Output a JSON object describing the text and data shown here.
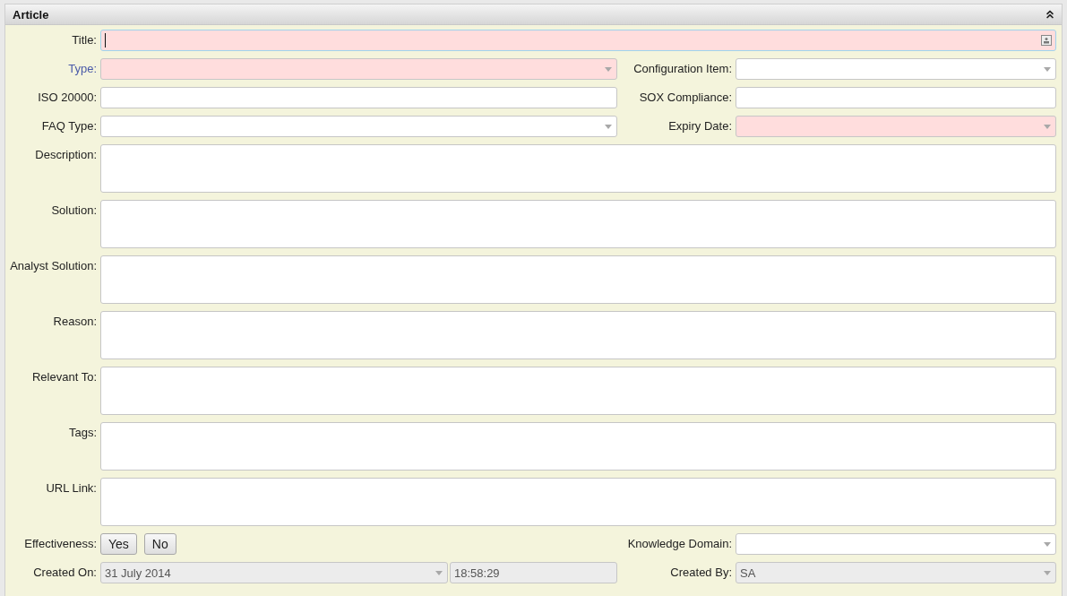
{
  "panel": {
    "title": "Article",
    "collapsed": false
  },
  "rows": [
    {
      "cells": [
        {
          "label": "Title:",
          "kind": "lookup",
          "required": true,
          "focused": true,
          "label_highlighted": false
        }
      ]
    },
    {
      "cells": [
        {
          "label": "Type:",
          "kind": "dropdown",
          "required": true,
          "label_highlighted": true
        },
        {
          "label": "Configuration Item:",
          "kind": "dropdown",
          "required": false,
          "label_highlighted": false
        }
      ]
    },
    {
      "cells": [
        {
          "label": "ISO 20000:",
          "kind": "text",
          "required": false,
          "label_highlighted": false
        },
        {
          "label": "SOX Compliance:",
          "kind": "text",
          "required": false,
          "label_highlighted": false
        }
      ]
    },
    {
      "cells": [
        {
          "label": "FAQ Type:",
          "kind": "dropdown",
          "required": false,
          "label_highlighted": false
        },
        {
          "label": "Expiry Date:",
          "kind": "dropdown",
          "required": true,
          "label_highlighted": false
        }
      ]
    },
    {
      "cells": [
        {
          "label": "Description:",
          "kind": "textarea",
          "required": false,
          "label_highlighted": false
        }
      ]
    },
    {
      "cells": [
        {
          "label": "Solution:",
          "kind": "textarea",
          "required": false,
          "label_highlighted": false
        }
      ]
    },
    {
      "cells": [
        {
          "label": "Analyst Solution:",
          "kind": "textarea",
          "required": false,
          "label_highlighted": false
        }
      ]
    },
    {
      "cells": [
        {
          "label": "Reason:",
          "kind": "textarea",
          "required": false,
          "label_highlighted": false
        }
      ]
    },
    {
      "cells": [
        {
          "label": "Relevant To:",
          "kind": "textarea",
          "required": false,
          "label_highlighted": false
        }
      ]
    },
    {
      "cells": [
        {
          "label": "Tags:",
          "kind": "textarea",
          "required": false,
          "label_highlighted": false
        }
      ]
    },
    {
      "cells": [
        {
          "label": "URL Link:",
          "kind": "textarea",
          "required": false,
          "label_highlighted": false
        }
      ]
    },
    {
      "cells": [
        {
          "label": "Effectiveness:",
          "kind": "buttons",
          "buttons": [
            "Yes",
            "No"
          ],
          "label_highlighted": false
        },
        {
          "label": "Knowledge Domain:",
          "kind": "dropdown",
          "required": false,
          "label_highlighted": false
        }
      ]
    },
    {
      "cells": [
        {
          "label": "Created On:",
          "kind": "datetime",
          "value": "31 July 2014",
          "time": "18:58:29",
          "disabled": true,
          "label_highlighted": false
        },
        {
          "label": "Created By:",
          "kind": "dropdown",
          "value": "SA",
          "disabled": true,
          "label_highlighted": false
        }
      ]
    }
  ]
}
